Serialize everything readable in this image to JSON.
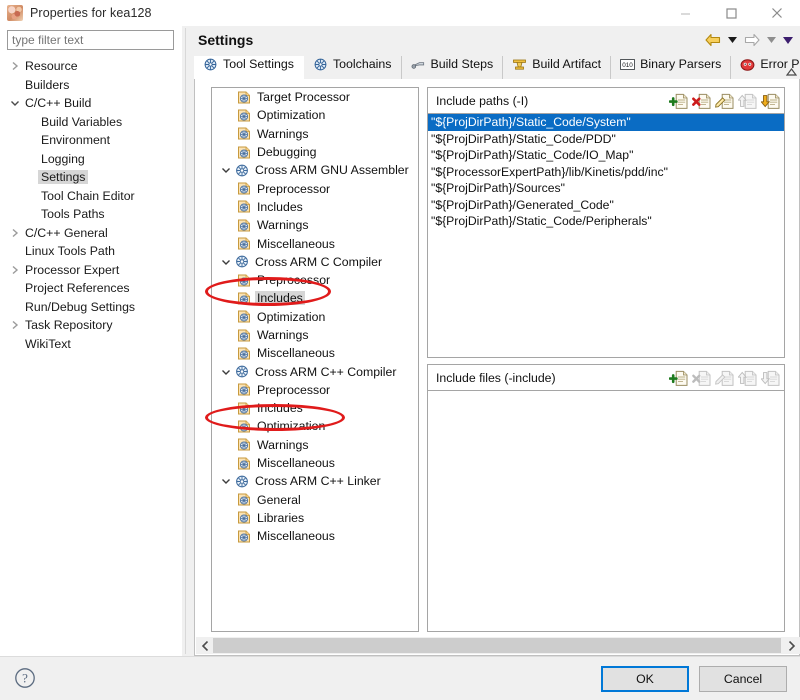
{
  "window": {
    "title": "Properties for kea128",
    "icon": "app-icon",
    "controls": {
      "minimize": "–",
      "maximize": "□",
      "close": "✕"
    }
  },
  "sidebar": {
    "filter_placeholder": "type filter text",
    "filter_value": "",
    "items": [
      {
        "label": "Resource",
        "indent": 1,
        "twisty": "collapsed",
        "selected": false
      },
      {
        "label": "Builders",
        "indent": 1,
        "twisty": "none",
        "selected": false
      },
      {
        "label": "C/C++ Build",
        "indent": 1,
        "twisty": "expanded",
        "selected": false
      },
      {
        "label": "Build Variables",
        "indent": 2,
        "twisty": "none",
        "selected": false
      },
      {
        "label": "Environment",
        "indent": 2,
        "twisty": "none",
        "selected": false
      },
      {
        "label": "Logging",
        "indent": 2,
        "twisty": "none",
        "selected": false
      },
      {
        "label": "Settings",
        "indent": 2,
        "twisty": "none",
        "selected": true
      },
      {
        "label": "Tool Chain Editor",
        "indent": 2,
        "twisty": "none",
        "selected": false
      },
      {
        "label": "Tools Paths",
        "indent": 2,
        "twisty": "none",
        "selected": false
      },
      {
        "label": "C/C++ General",
        "indent": 1,
        "twisty": "collapsed",
        "selected": false
      },
      {
        "label": "Linux Tools Path",
        "indent": 1,
        "twisty": "none",
        "selected": false
      },
      {
        "label": "Processor Expert",
        "indent": 1,
        "twisty": "collapsed",
        "selected": false
      },
      {
        "label": "Project References",
        "indent": 1,
        "twisty": "none",
        "selected": false
      },
      {
        "label": "Run/Debug Settings",
        "indent": 1,
        "twisty": "none",
        "selected": false
      },
      {
        "label": "Task Repository",
        "indent": 1,
        "twisty": "collapsed",
        "selected": false
      },
      {
        "label": "WikiText",
        "indent": 1,
        "twisty": "none",
        "selected": false
      }
    ]
  },
  "pane": {
    "title": "Settings",
    "nav": {
      "back_icon": "back-arrow-icon",
      "back_caret_icon": "chevron-down-icon",
      "forward_icon": "forward-arrow-icon",
      "forward_caret_icon": "chevron-down-icon",
      "menu_caret_icon": "chevron-down-icon"
    },
    "tabs": [
      {
        "label": "Tool Settings",
        "icon": "gear-blue-icon",
        "active": true
      },
      {
        "label": "Toolchains",
        "icon": "gear-blue-icon",
        "active": false
      },
      {
        "label": "Build Steps",
        "icon": "wrench-icon",
        "active": false
      },
      {
        "label": "Build Artifact",
        "icon": "anvil-icon",
        "active": false
      },
      {
        "label": "Binary Parsers",
        "icon": "binary-010-icon",
        "active": false
      },
      {
        "label": "Error Parser",
        "icon": "error-red-icon",
        "active": false
      }
    ],
    "tab_scroll_icon": "chevron-up-icon"
  },
  "option_tree": [
    {
      "label": "Target Processor",
      "level": 1,
      "twisty": "none",
      "icon": "page-option-icon",
      "highlight": false
    },
    {
      "label": "Optimization",
      "level": 1,
      "twisty": "none",
      "icon": "page-option-icon",
      "highlight": false
    },
    {
      "label": "Warnings",
      "level": 1,
      "twisty": "none",
      "icon": "page-option-icon",
      "highlight": false
    },
    {
      "label": "Debugging",
      "level": 1,
      "twisty": "none",
      "icon": "page-option-icon",
      "highlight": false
    },
    {
      "label": "Cross ARM GNU Assembler",
      "level": 0,
      "twisty": "expanded",
      "icon": "tool-gear-icon",
      "highlight": false
    },
    {
      "label": "Preprocessor",
      "level": 1,
      "twisty": "none",
      "icon": "page-option-icon",
      "highlight": false
    },
    {
      "label": "Includes",
      "level": 1,
      "twisty": "none",
      "icon": "page-option-icon",
      "highlight": false
    },
    {
      "label": "Warnings",
      "level": 1,
      "twisty": "none",
      "icon": "page-option-icon",
      "highlight": false
    },
    {
      "label": "Miscellaneous",
      "level": 1,
      "twisty": "none",
      "icon": "page-option-icon",
      "highlight": false
    },
    {
      "label": "Cross ARM C Compiler",
      "level": 0,
      "twisty": "expanded",
      "icon": "tool-gear-icon",
      "highlight": false
    },
    {
      "label": "Preprocessor",
      "level": 1,
      "twisty": "none",
      "icon": "page-option-icon",
      "highlight": false
    },
    {
      "label": "Includes",
      "level": 1,
      "twisty": "none",
      "icon": "page-option-icon",
      "highlight": true
    },
    {
      "label": "Optimization",
      "level": 1,
      "twisty": "none",
      "icon": "page-option-icon",
      "highlight": false
    },
    {
      "label": "Warnings",
      "level": 1,
      "twisty": "none",
      "icon": "page-option-icon",
      "highlight": false
    },
    {
      "label": "Miscellaneous",
      "level": 1,
      "twisty": "none",
      "icon": "page-option-icon",
      "highlight": false
    },
    {
      "label": "Cross ARM C++ Compiler",
      "level": 0,
      "twisty": "expanded",
      "icon": "tool-gear-icon",
      "highlight": false
    },
    {
      "label": "Preprocessor",
      "level": 1,
      "twisty": "none",
      "icon": "page-option-icon",
      "highlight": false
    },
    {
      "label": "Includes",
      "level": 1,
      "twisty": "none",
      "icon": "page-option-icon",
      "highlight": false
    },
    {
      "label": "Optimization",
      "level": 1,
      "twisty": "none",
      "icon": "page-option-icon",
      "highlight": false
    },
    {
      "label": "Warnings",
      "level": 1,
      "twisty": "none",
      "icon": "page-option-icon",
      "highlight": false
    },
    {
      "label": "Miscellaneous",
      "level": 1,
      "twisty": "none",
      "icon": "page-option-icon",
      "highlight": false
    },
    {
      "label": "Cross ARM C++ Linker",
      "level": 0,
      "twisty": "expanded",
      "icon": "tool-gear-icon",
      "highlight": false
    },
    {
      "label": "General",
      "level": 1,
      "twisty": "none",
      "icon": "page-option-icon",
      "highlight": false
    },
    {
      "label": "Libraries",
      "level": 1,
      "twisty": "none",
      "icon": "page-option-icon",
      "highlight": false
    },
    {
      "label": "Miscellaneous",
      "level": 1,
      "twisty": "none",
      "icon": "page-option-icon",
      "highlight": false
    }
  ],
  "annotations": [
    {
      "shape": "ellipse",
      "target": "includes-c-compiler",
      "color": "#e01b1b"
    },
    {
      "shape": "ellipse",
      "target": "includes-cpp-compiler",
      "color": "#e01b1b"
    }
  ],
  "include_paths": {
    "title": "Include paths (-I)",
    "tools": [
      {
        "name": "add-icon",
        "enabled": true
      },
      {
        "name": "delete-icon",
        "enabled": true
      },
      {
        "name": "edit-icon",
        "enabled": true
      },
      {
        "name": "move-up-icon",
        "enabled": false
      },
      {
        "name": "move-down-icon",
        "enabled": true
      }
    ],
    "items": [
      {
        "value": "\"${ProjDirPath}/Static_Code/System\"",
        "selected": true
      },
      {
        "value": "\"${ProjDirPath}/Static_Code/PDD\"",
        "selected": false
      },
      {
        "value": "\"${ProjDirPath}/Static_Code/IO_Map\"",
        "selected": false
      },
      {
        "value": "\"${ProcessorExpertPath}/lib/Kinetis/pdd/inc\"",
        "selected": false
      },
      {
        "value": "\"${ProjDirPath}/Sources\"",
        "selected": false
      },
      {
        "value": "\"${ProjDirPath}/Generated_Code\"",
        "selected": false
      },
      {
        "value": "\"${ProjDirPath}/Static_Code/Peripherals\"",
        "selected": false
      }
    ]
  },
  "include_files": {
    "title": "Include files (-include)",
    "tools": [
      {
        "name": "add-icon",
        "enabled": true
      },
      {
        "name": "delete-icon",
        "enabled": false
      },
      {
        "name": "edit-icon",
        "enabled": false
      },
      {
        "name": "move-up-icon",
        "enabled": false
      },
      {
        "name": "move-down-icon",
        "enabled": false
      }
    ],
    "items": []
  },
  "scrollbar": {
    "left_arrow": "chevron-left-icon",
    "right_arrow": "chevron-right-icon"
  },
  "footer": {
    "help_icon": "help-question-icon",
    "ok_label": "OK",
    "cancel_label": "Cancel"
  },
  "colors": {
    "selection_blue": "#0a6cc4",
    "focus_blue": "#0078d7",
    "annotation_red": "#e01b1b",
    "highlight_grey": "#d6d6d6"
  }
}
